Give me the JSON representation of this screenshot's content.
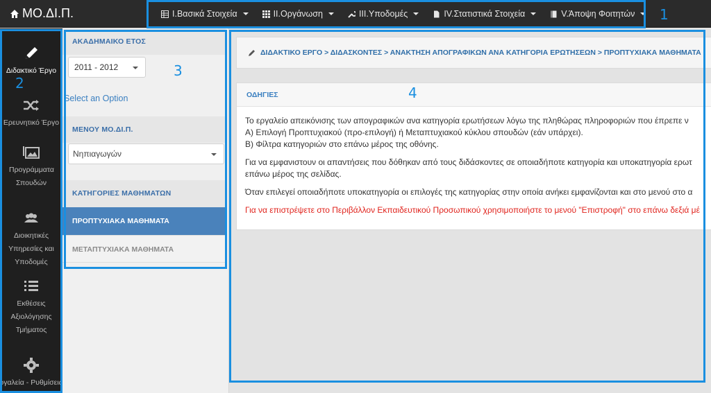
{
  "brand": {
    "title": "ΜΟ.ΔΙ.Π."
  },
  "topnav": [
    {
      "label": "I.Βασικά Στοιχεία",
      "icon": "table-icon"
    },
    {
      "label": "II.Οργάνωση",
      "icon": "grid-icon"
    },
    {
      "label": "III.Υποδομές",
      "icon": "wrench-icon"
    },
    {
      "label": "IV.Στατιστικά Στοιχεία",
      "icon": "file-icon"
    },
    {
      "label": "V.Άποψη Φοιτητών",
      "icon": "book-icon"
    }
  ],
  "iconbar": [
    {
      "label": "Διδακτικό Έργο",
      "icon": "pencil-icon"
    },
    {
      "label": "Ερευνητικό Έργο",
      "icon": "shuffle-icon"
    },
    {
      "label": "Προγράμματα Σπουδών",
      "icon": "pictures-icon"
    },
    {
      "label": "Διοικητικές Υπηρεσίες και Υποδομές",
      "icon": "users-icon"
    },
    {
      "label": "Εκθέσεις Αξιολόγησης Τμήματος",
      "icon": "list-icon"
    },
    {
      "label": "Εργαλεία - Ρυθμίσεις",
      "icon": "gear-icon"
    }
  ],
  "side": {
    "year_header": "ΑΚΑΔΗΜΑΙΚΟ ΕΤΟΣ",
    "year_value": "2011 - 2012",
    "select_option": "Select an Option",
    "menu_header": "ΜΕΝΟΥ ΜΟ.ΔΙ.Π.",
    "menu_value": "Νηπιαγωγών",
    "categories_header": "ΚΑΤΗΓΟΡΙΕΣ ΜΑΘΗΜΑΤΩΝ",
    "tab_active": "ΠΡΟΠΤΥΧΙΑΚΑ ΜΑΘΗΜΑΤΑ",
    "tab_inactive": "ΜΕΤΑΠΤΥΧΙΑΚΑ ΜΑΘΗΜΑΤΑ"
  },
  "breadcrumb": "ΔΙΔΑΚΤΙΚΟ ΕΡΓΟ > ΔΙΔΑΣΚΟΝΤΕΣ > ΑΝΑΚΤΗΣΗ ΑΠΟΓΡΑΦΙΚΩΝ ΑΝΑ ΚΑΤΗΓΟΡΙΑ ΕΡΩΤΗΣΕΩΝ > ΠΡΟΠΤΥΧΙΑΚΑ ΜΑΘΗΜΑΤΑ",
  "panel": {
    "title": "ΟΔΗΓΙΕΣ",
    "line1": "Το εργαλείο απεικόνισης των απογραφικών ανα κατηγορία ερωτήσεων λόγω της πληθώρας πληροφοριών που έπρεπε ν",
    "line2": "A) Επιλογή Προπτυχιακού (προ-επιλογή) ή Μεταπτυχιακού κύκλου σπουδών (εάν υπάρχει).",
    "line3": "B) Φίλτρα κατηγοριών στο επάνω μέρος της οθόνης.",
    "line4": "Για να εμφανιστουν οι απαντήσεις που δόθηκαν από τους διδάσκοντες σε οποιαδήποτε κατηγορία και υποκατηγορία ερωτ",
    "line5": "επάνω μέρος της σελίδας.",
    "line6": "Όταν επιλεγεί οποιαδήποτε υποκατηγορία οι επιλογές της κατηγορίας στην οποία ανήκει εμφανίζονται και στο μενού στο α",
    "line7": "Για να επιστρέψετε στο Περιβάλλον Εκπαιδευτικού Προσωπικού χρησιμοποιήστε το μενού \"Επιστροφή\" στο επάνω δεξιά μέ"
  },
  "annotations": [
    "1",
    "2",
    "3",
    "4"
  ],
  "colors": {
    "annotation": "#1a8fe0",
    "active_tab": "#4a82bb",
    "warning_text": "#e0231c",
    "link": "#3a7fc0"
  }
}
